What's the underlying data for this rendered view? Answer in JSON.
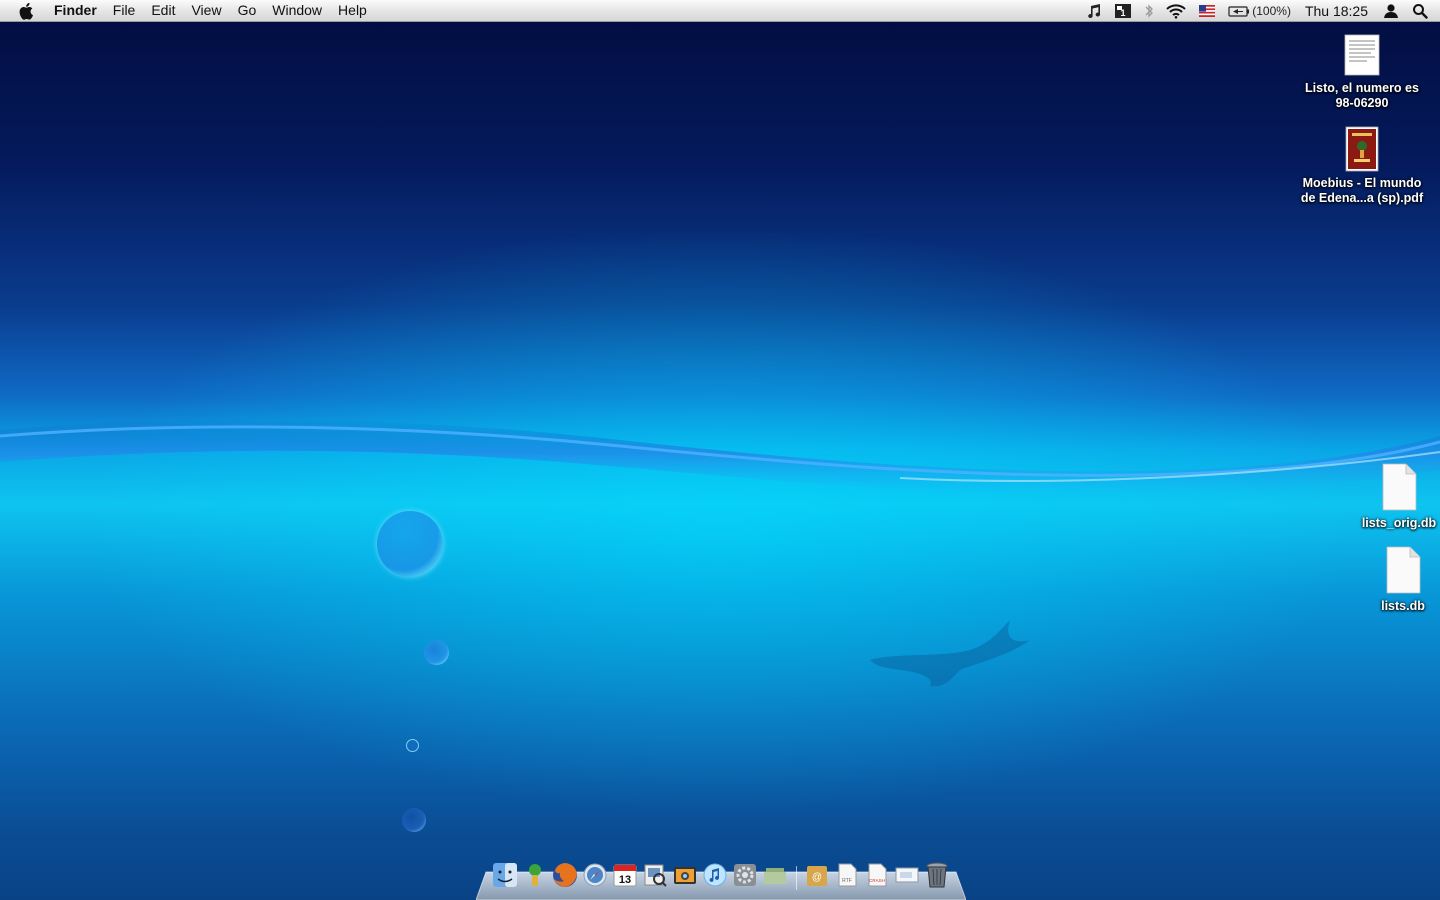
{
  "menubar": {
    "app_name": "Finder",
    "menus": [
      "File",
      "Edit",
      "View",
      "Go",
      "Window",
      "Help"
    ],
    "battery_percent": "(100%)",
    "clock": "Thu 18:25",
    "status_icons": [
      "itunes-note-icon",
      "spaces-icon",
      "bluetooth-icon",
      "wifi-icon",
      "us-flag-input-icon",
      "battery-icon",
      "user-icon",
      "spotlight-search-icon"
    ]
  },
  "desktop": {
    "icons": [
      {
        "line1": "Listo, el numero es",
        "line2": "98-06290",
        "kind": "text-document-icon"
      },
      {
        "line1": "Moebius - El mundo",
        "line2": "de Edena...a (sp).pdf",
        "kind": "pdf-document-icon"
      },
      {
        "line1": "lists_orig.db",
        "line2": "",
        "kind": "blank-document-icon"
      },
      {
        "line1": "lists.db",
        "line2": "",
        "kind": "blank-document-icon"
      }
    ]
  },
  "dock": {
    "apps": [
      "finder-icon",
      "sourcetree-icon",
      "firefox-icon",
      "safari-icon",
      "ical-icon",
      "preview-icon",
      "iphoto-icon",
      "itunes-icon",
      "system-preferences-icon",
      "stacks-icon"
    ],
    "others": [
      "applications-folder-icon",
      "rtf-document-icon",
      "crash-document-icon",
      "screen-icon",
      "trash-icon"
    ],
    "ical_day": "13"
  },
  "colors": {
    "sky_top": "#020c3e",
    "water_highlight": "#0ec4f0",
    "deep_water": "#0a4286"
  }
}
